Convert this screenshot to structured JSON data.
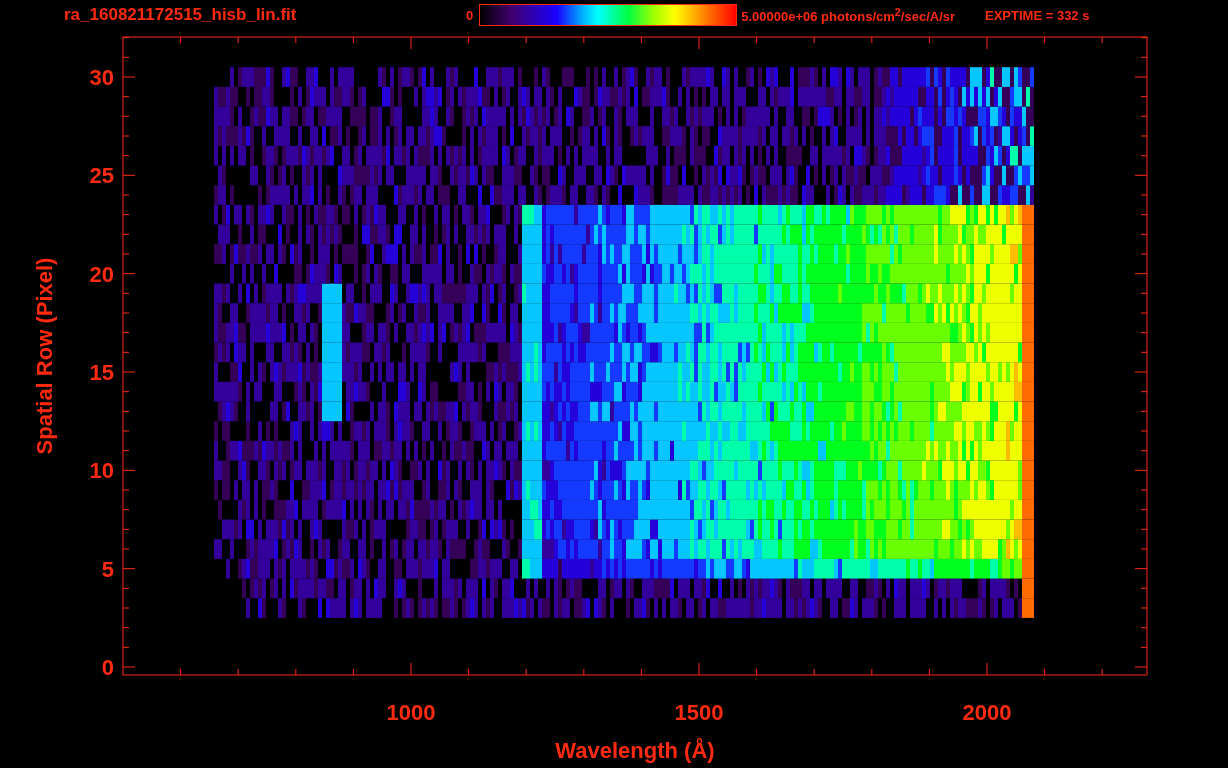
{
  "title": "ra_160821172515_hisb_lin.fit",
  "colorbar": {
    "min_label": "0",
    "max_label": "5.00000e+06 photons/cm$^{2}$/sec/A/sr"
  },
  "exposure": "EXPTIME = 332 s",
  "plot": {
    "xlabel": "Wavelength (Å)",
    "ylabel": "Spatial Row (Pixel)",
    "xtick_labels": [
      "1000",
      "1500",
      "2000"
    ],
    "ytick_labels": [
      "30",
      "25",
      "20",
      "15",
      "10",
      "5",
      "0"
    ]
  }
}
